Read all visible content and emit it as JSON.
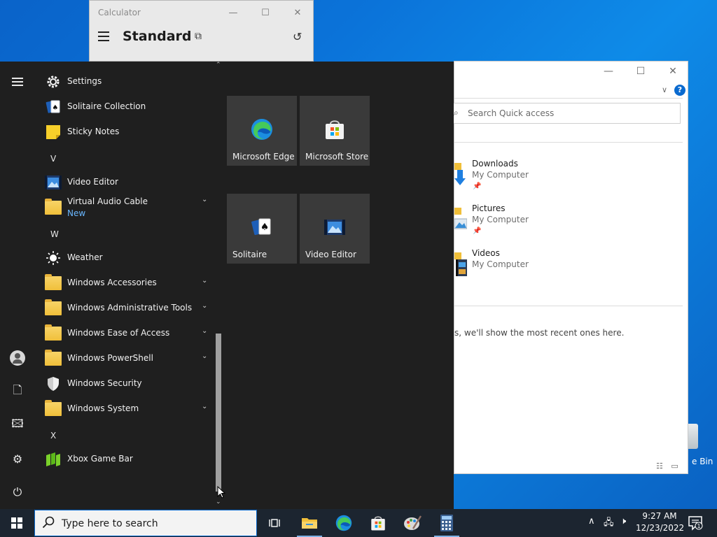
{
  "calculator": {
    "title": "Calculator",
    "mode": "Standard",
    "min_glyph": "—",
    "max_glyph": "☐",
    "close_glyph": "✕",
    "keep_on_top_glyph": "⧉",
    "history_glyph": "↺"
  },
  "explorer": {
    "min_glyph": "—",
    "max_glyph": "☐",
    "close_glyph": "✕",
    "chevron_glyph": "∨",
    "help_glyph": "?",
    "search_placeholder": "Search Quick access",
    "search_glyph": "⌕",
    "quick_access": [
      {
        "name": "Downloads",
        "location": "My Computer"
      },
      {
        "name": "Pictures",
        "location": "My Computer"
      },
      {
        "name": "Videos",
        "location": "My Computer"
      }
    ],
    "pin_glyph": "📌",
    "recent_text": "s, we'll show the most recent ones here.",
    "views_glyph": "☷ ▭"
  },
  "desktop": {
    "recycle_bin_label": "e Bin"
  },
  "start_menu": {
    "scroll_up_glyph": "⌃",
    "scroll_down_glyph": "⌄",
    "chevron_glyph": "⌄",
    "rail": {
      "documents_glyph": "🗋",
      "pictures_glyph": "🖾",
      "settings_glyph": "⚙",
      "power_glyph": "⏻"
    },
    "apps": {
      "settings": "Settings",
      "solitaire_collection": "Solitaire Collection",
      "sticky_notes": "Sticky Notes",
      "letter_v": "V",
      "video_editor": "Video Editor",
      "virtual_audio_cable": "Virtual Audio Cable",
      "virtual_audio_cable_badge": "New",
      "letter_w": "W",
      "weather": "Weather",
      "windows_accessories": "Windows Accessories",
      "windows_admin_tools": "Windows Administrative Tools",
      "windows_ease_of_access": "Windows Ease of Access",
      "windows_powershell": "Windows PowerShell",
      "windows_security": "Windows Security",
      "windows_system": "Windows System",
      "letter_x": "X",
      "xbox_game_bar": "Xbox Game Bar"
    },
    "tiles": {
      "edge": "Microsoft Edge",
      "store": "Microsoft Store",
      "solitaire": "Solitaire",
      "video_editor": "Video Editor"
    }
  },
  "taskbar": {
    "search_placeholder": "Type here to search",
    "tray_chevron_glyph": "∧",
    "network_glyph": "🖧",
    "volume_glyph": "🕨",
    "time": "9:27 AM",
    "date": "12/23/2022",
    "notification_count": "1"
  }
}
